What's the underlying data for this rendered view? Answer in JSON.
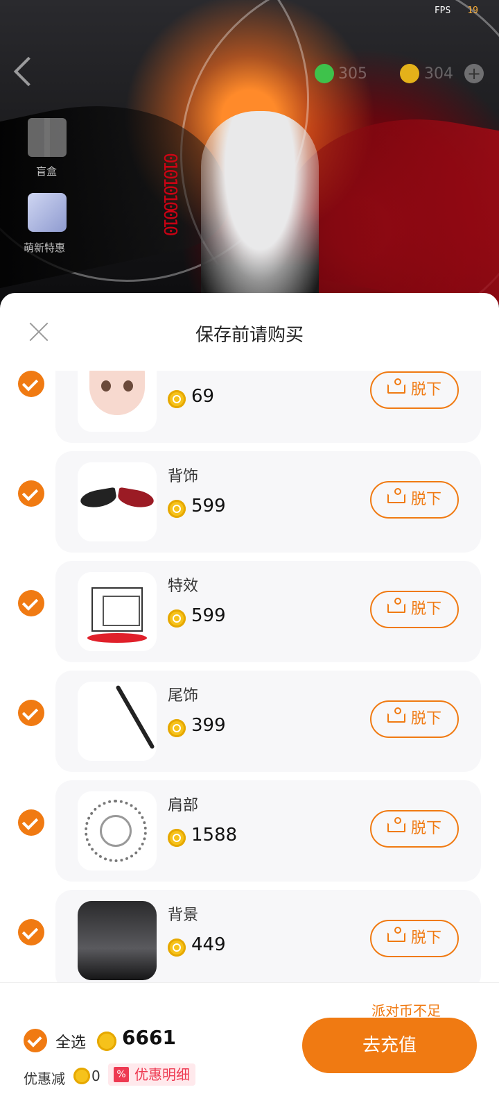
{
  "status": {
    "fps_label": "FPS",
    "fps_value": "19"
  },
  "topbar": {
    "green_coins": "305",
    "gold_coins": "304"
  },
  "side": {
    "blindbox_label": "盲盒",
    "promo_label": "萌新特惠"
  },
  "sheet": {
    "title": "保存前请购买"
  },
  "items": [
    {
      "name": "",
      "price": "69",
      "action": "脱下"
    },
    {
      "name": "背饰",
      "price": "599",
      "action": "脱下"
    },
    {
      "name": "特效",
      "price": "599",
      "action": "脱下"
    },
    {
      "name": "尾饰",
      "price": "399",
      "action": "脱下"
    },
    {
      "name": "肩部",
      "price": "1588",
      "action": "脱下"
    },
    {
      "name": "背景",
      "price": "449",
      "action": "脱下"
    }
  ],
  "footer": {
    "warning": "派对币不足",
    "select_all": "全选",
    "total": "6661",
    "discount_label": "优惠减",
    "discount_value": "0",
    "discount_tag": "优惠明细",
    "recharge": "去充值"
  },
  "colors": {
    "accent": "#f07a12",
    "coin": "#f6c21b",
    "discount": "#ee3a52"
  }
}
